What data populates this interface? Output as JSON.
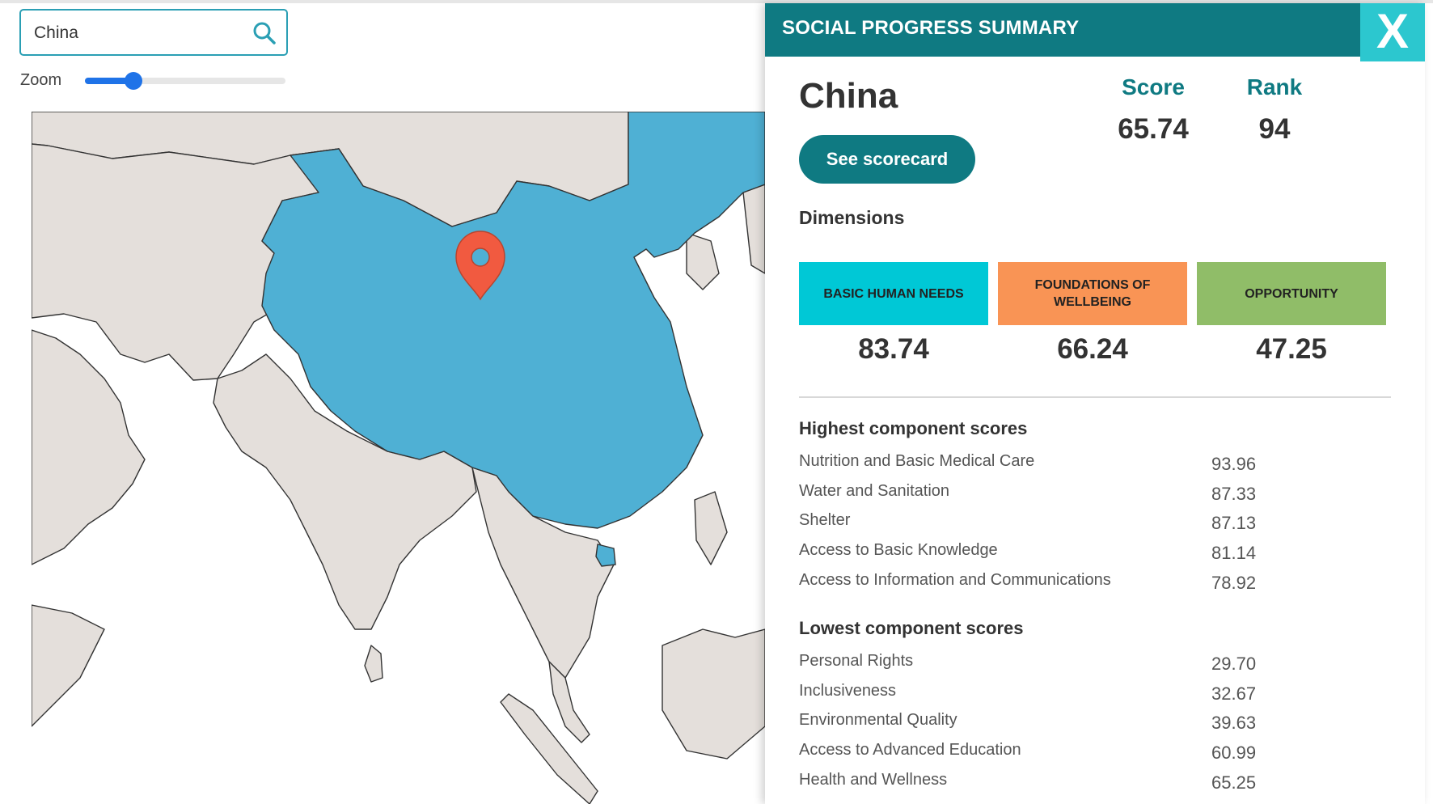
{
  "search": {
    "value": "China",
    "placeholder": ""
  },
  "zoom": {
    "label": "Zoom",
    "level": 0.24
  },
  "colors": {
    "accent": "#0f7a82",
    "close": "#2cc7cf",
    "china": "#4fb0d4",
    "land": "#e4dfdb",
    "marker": "#f15a40",
    "basic_human_needs": "#00c8d6",
    "foundations_of_wellbeing": "#f99455",
    "opportunity": "#90bd68"
  },
  "panel": {
    "title": "SOCIAL PROGRESS SUMMARY",
    "close_label": "X",
    "country": "China",
    "score_label": "Score",
    "score": "65.74",
    "rank_label": "Rank",
    "rank": "94",
    "scorecard_button": "See scorecard",
    "dimensions_title": "Dimensions",
    "dimensions": [
      {
        "label": "BASIC HUMAN NEEDS",
        "value": "83.74"
      },
      {
        "label": "FOUNDATIONS OF WELLBEING",
        "value": "66.24"
      },
      {
        "label": "OPPORTUNITY",
        "value": "47.25"
      }
    ],
    "highest_title": "Highest component scores",
    "highest": [
      {
        "name": "Nutrition and Basic Medical Care",
        "value": "93.96"
      },
      {
        "name": "Water and Sanitation",
        "value": "87.33"
      },
      {
        "name": "Shelter",
        "value": "87.13"
      },
      {
        "name": "Access to Basic Knowledge",
        "value": "81.14"
      },
      {
        "name": "Access to Information and Communications",
        "value": "78.92"
      }
    ],
    "lowest_title": "Lowest component scores",
    "lowest": [
      {
        "name": "Personal Rights",
        "value": "29.70"
      },
      {
        "name": "Inclusiveness",
        "value": "32.67"
      },
      {
        "name": "Environmental Quality",
        "value": "39.63"
      },
      {
        "name": "Access to Advanced Education",
        "value": "60.99"
      },
      {
        "name": "Health and Wellness",
        "value": "65.25"
      }
    ]
  },
  "map": {
    "marker_icon": "map-pin-icon"
  }
}
